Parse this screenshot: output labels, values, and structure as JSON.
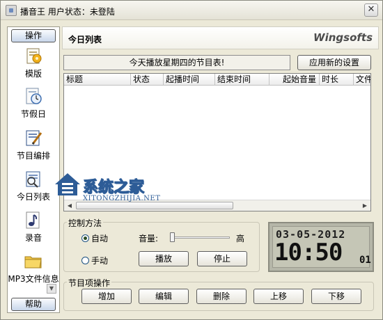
{
  "window": {
    "title": "播音王  用户状态：未登陆",
    "close_label": "✕"
  },
  "sidebar": {
    "top_button": "操作",
    "bottom_button": "帮助",
    "items": [
      {
        "label": "模版",
        "icon": "template-icon"
      },
      {
        "label": "节假日",
        "icon": "holiday-clock-icon"
      },
      {
        "label": "节目编排",
        "icon": "program-edit-icon"
      },
      {
        "label": "今日列表",
        "icon": "today-list-icon"
      },
      {
        "label": "录音",
        "icon": "music-note-icon"
      },
      {
        "label": "MP3文件信息",
        "icon": "folder-icon"
      }
    ]
  },
  "header": {
    "title": "今日列表",
    "brand": "Wingsofts"
  },
  "banner": {
    "text": "今天播放星期四的节目表!",
    "apply_button": "应用新的设置"
  },
  "table": {
    "columns": [
      "标题",
      "状态",
      "起播时间",
      "结束时间",
      "起始音量",
      "时长",
      "文件"
    ],
    "rows": []
  },
  "control": {
    "group_title": "控制方法",
    "auto_label": "自动",
    "manual_label": "手动",
    "selected": "自动",
    "volume_label": "音量:",
    "volume_high_label": "高",
    "volume_level": 0.0,
    "play_button": "播放",
    "stop_button": "停止"
  },
  "clock": {
    "date": "03-05-2012",
    "time": "10:50",
    "seconds": "01"
  },
  "items_ops": {
    "group_title": "节目项操作",
    "buttons": [
      "增加",
      "编辑",
      "删除",
      "上移",
      "下移"
    ]
  },
  "watermark": {
    "text": "系统之家",
    "sub": "XITONGZHIJIA.NET"
  },
  "colors": {
    "window_bg": "#ece9d8",
    "watermark_blue": "#2d5c97",
    "lcd_bg": "#c5c6b6"
  }
}
